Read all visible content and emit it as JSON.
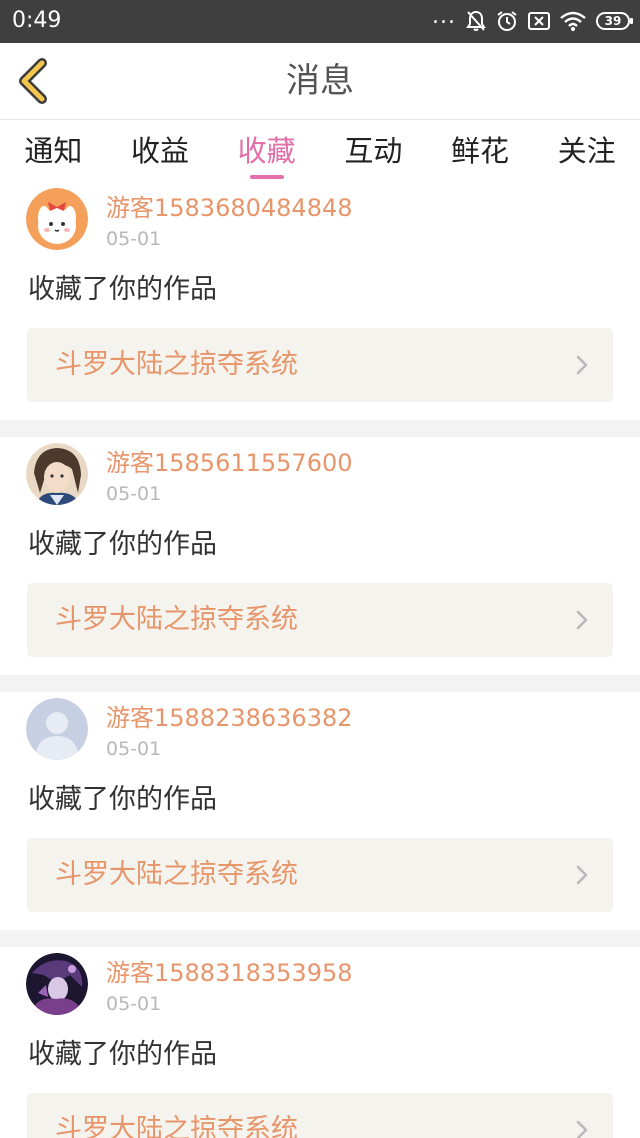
{
  "status_bar": {
    "time": "0:49",
    "dots": "...",
    "battery": "39",
    "icons": [
      "notifications-off-icon",
      "alarm-icon",
      "sim-off-icon",
      "wifi-icon",
      "battery-icon"
    ]
  },
  "header": {
    "title": "消息",
    "back_icon": "chevron-left-icon",
    "accent_color": "#f3c64e"
  },
  "tabs": {
    "active_color": "#e26fa7",
    "items": [
      {
        "label": "通知",
        "active": false
      },
      {
        "label": "收益",
        "active": false
      },
      {
        "label": "收藏",
        "active": true
      },
      {
        "label": "互动",
        "active": false
      },
      {
        "label": "鲜花",
        "active": false
      },
      {
        "label": "关注",
        "active": false
      }
    ]
  },
  "messages": [
    {
      "user": "游客1583680484848",
      "date": "05-01",
      "action": "收藏了你的作品",
      "work": "斗罗大陆之掠夺系统",
      "avatar_icon": "cartoon-avatar-icon"
    },
    {
      "user": "游客1585611557600",
      "date": "05-01",
      "action": "收藏了你的作品",
      "work": "斗罗大陆之掠夺系统",
      "avatar_icon": "anime-character-avatar-icon"
    },
    {
      "user": "游客1588238636382",
      "date": "05-01",
      "action": "收藏了你的作品",
      "work": "斗罗大陆之掠夺系统",
      "avatar_icon": "default-user-avatar-icon"
    },
    {
      "user": "游客1588318353958",
      "date": "05-01",
      "action": "收藏了你的作品",
      "work": "斗罗大陆之掠夺系统",
      "avatar_icon": "anime-character-avatar-icon"
    }
  ],
  "colors": {
    "username": "#e7956a",
    "work_title": "#e7956a",
    "work_bg": "#f4f3ed",
    "date": "#b8b8b8",
    "status_bar_bg": "#3f3f3f"
  }
}
